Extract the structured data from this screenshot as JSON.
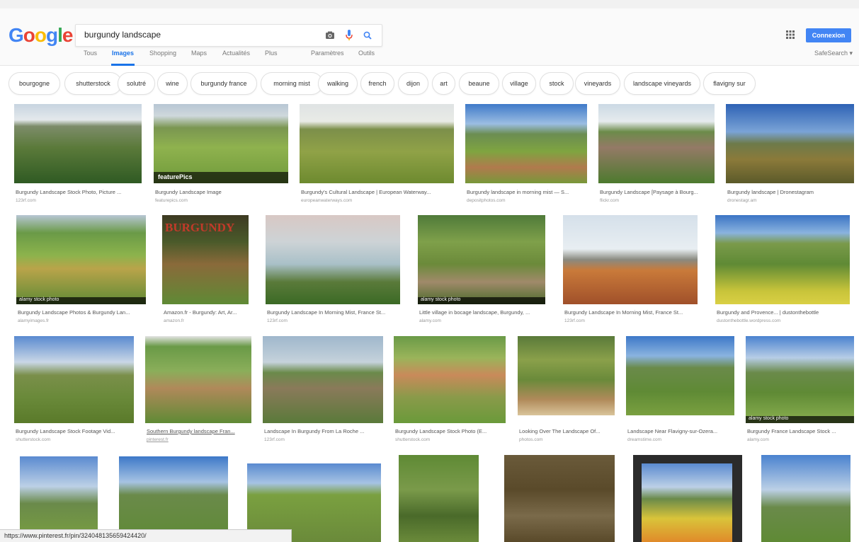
{
  "search": {
    "query": "burgundy landscape"
  },
  "header": {
    "signin_label": "Connexion",
    "safesearch": "SafeSearch ▾"
  },
  "tabs": [
    "Tous",
    "Images",
    "Shopping",
    "Maps",
    "Actualités",
    "Plus",
    "Paramètres",
    "Outils"
  ],
  "chips": [
    "bourgogne",
    "shutterstock",
    "solutré",
    "wine",
    "burgundy france",
    "morning mist",
    "walking",
    "french",
    "dijon",
    "art",
    "beaune",
    "village",
    "stock",
    "vineyards",
    "landscape vineyards",
    "flavigny sur"
  ],
  "rows": [
    [
      {
        "caption": "Burgundy Landscape Stock Photo, Picture ...",
        "source": "123rf.com"
      },
      {
        "caption": "Burgundy Landscape Image",
        "source": "featurepics.com",
        "overlay": "featurePics"
      },
      {
        "caption": "Burgundy's Cultural Landscape | European Waterway...",
        "source": "europeanwaterways.com"
      },
      {
        "caption": "Burgundy landscape in morning mist — S...",
        "source": "depositphotos.com"
      },
      {
        "caption": "Burgundy Landscape [Paysage à Bourg...",
        "source": "flickr.com"
      },
      {
        "caption": "Burgundy landscape | Dronestagram",
        "source": "dronestagr.am"
      }
    ],
    [
      {
        "caption": "Burgundy Landscape Photos & Burgundy Lan...",
        "source": "alamyimages.fr",
        "overlay": "alamy stock photo"
      },
      {
        "caption": "Amazon.fr - Burgundy: Art, Ar...",
        "source": "amazon.fr",
        "overlay": "BURGUNDY"
      },
      {
        "caption": "Burgundy Landscape In Morning Mist, France St...",
        "source": "123rf.com"
      },
      {
        "caption": "Little village in bocage landscape, Burgundy, ...",
        "source": "alamy.com",
        "overlay": "alamy stock photo"
      },
      {
        "caption": "Burgundy Landscape In Morning Mist, France St...",
        "source": "123rf.com"
      },
      {
        "caption": "Burgundy and Provence... | dustonthebottle",
        "source": "dustonthebottle.wordpress.com"
      }
    ],
    [
      {
        "caption": "Burgundy Landscape Stock Footage Vid...",
        "source": "shutterstock.com"
      },
      {
        "caption": "Southern Burgundy landscape Fran...",
        "source": "pinterest.fr"
      },
      {
        "caption": "Landscape In Burgundy From La Roche ...",
        "source": "123rf.com"
      },
      {
        "caption": "Burgundy Landscape Stock Photo (E...",
        "source": "shutterstock.com"
      },
      {
        "caption": "Looking Over The Landscape Of...",
        "source": "photos.com"
      },
      {
        "caption": "Landscape Near Flavigny-sur-Ozera...",
        "source": "dreamstime.com"
      },
      {
        "caption": "Burgundy France Landscape Stock ...",
        "source": "alamy.com",
        "overlay": "alamy stock photo"
      }
    ],
    [
      {},
      {},
      {},
      {},
      {},
      {},
      {}
    ]
  ],
  "statusbar": "https://www.pinterest.fr/pin/324048135659424420/"
}
